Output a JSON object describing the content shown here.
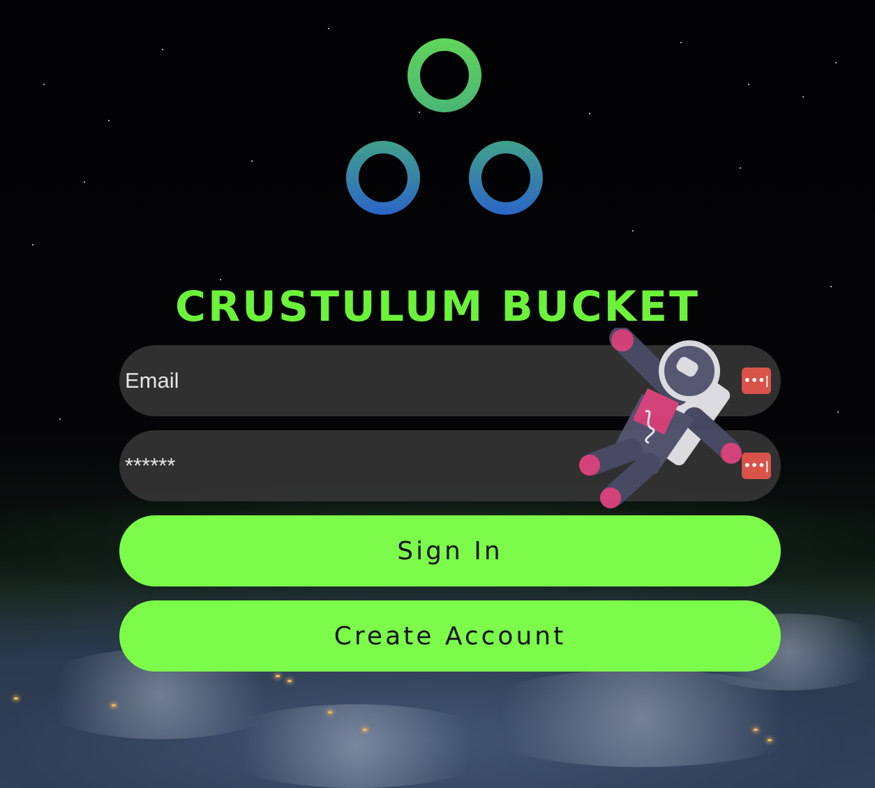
{
  "app": {
    "title": "CRUSTULUM BUCKET"
  },
  "form": {
    "email_placeholder": "Email",
    "password_placeholder": "******",
    "sign_in_label": "Sign In",
    "create_account_label": "Create Account"
  },
  "colors": {
    "accent_green": "#7cfb4b",
    "title_green": "#6cf23a",
    "field_bg": "#343434",
    "password_key_red": "#d9534a",
    "logo_gradient_top": "#5fd45a",
    "logo_gradient_bottom": "#2a64c9"
  },
  "icons": {
    "logo": "three-rings-logo-icon",
    "password_manager": "password-key-icon",
    "overlay_sticker": "astronaut-icon"
  }
}
